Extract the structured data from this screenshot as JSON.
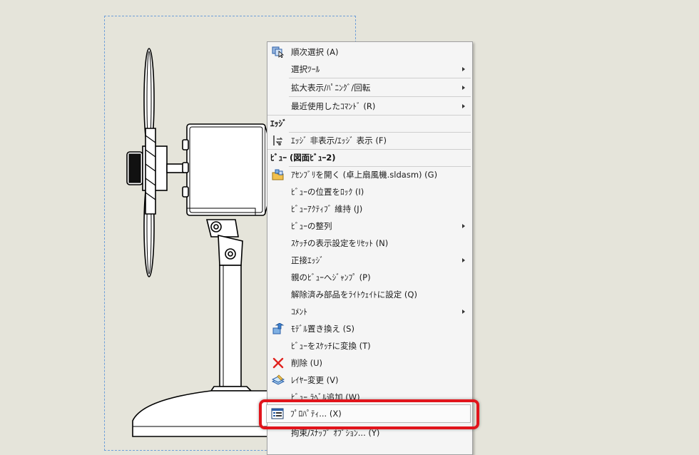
{
  "menu": {
    "items": [
      {
        "label": "順次選択 (A)",
        "icon": "select-other-icon",
        "submenu": false
      },
      {
        "label": "選択ﾂｰﾙ",
        "icon": "",
        "submenu": true
      },
      {
        "label": "拡大表示/ﾊﾟﾆﾝｸﾞ/回転",
        "icon": "",
        "submenu": true
      },
      {
        "label": "最近使用したｺﾏﾝﾄﾞ (R)",
        "icon": "",
        "submenu": true
      }
    ],
    "edge_header": "ｴｯｼﾞ",
    "edge_items": [
      {
        "label": "ｴｯｼﾞ 非表示/ｴｯｼﾞ 表示 (F)",
        "icon": "hide-show-edge-icon"
      }
    ],
    "view_header": "ﾋﾞｭｰ (図面ﾋﾞｭｰ2)",
    "view_items": [
      {
        "label": "ｱｾﾝﾌﾞﾘを開く (卓上扇風機.sldasm) (G)",
        "icon": "open-assembly-icon",
        "submenu": false
      },
      {
        "label": "ﾋﾞｭｰの位置をﾛｯｸ (I)",
        "icon": "",
        "submenu": false
      },
      {
        "label": "ﾋﾞｭｰｱｸﾃｨﾌﾞ 維持 (J)",
        "icon": "",
        "submenu": false
      },
      {
        "label": "ﾋﾞｭｰの整列",
        "icon": "",
        "submenu": true
      },
      {
        "label": "ｽｹｯﾁの表示設定をﾘｾｯﾄ (N)",
        "icon": "",
        "submenu": false
      },
      {
        "label": "正接ｴｯｼﾞ",
        "icon": "",
        "submenu": true
      },
      {
        "label": "親のﾋﾞｭｰへｼﾞｬﾝﾌﾟ (P)",
        "icon": "",
        "submenu": false
      },
      {
        "label": "解除済み部品をﾗｲﾄｳｪｲﾄに設定 (Q)",
        "icon": "",
        "submenu": false
      },
      {
        "label": "ｺﾒﾝﾄ",
        "icon": "",
        "submenu": true
      },
      {
        "label": "ﾓﾃﾞﾙ置き換え (S)",
        "icon": "replace-model-icon",
        "submenu": false
      },
      {
        "label": "ﾋﾞｭｰをｽｹｯﾁに変換 (T)",
        "icon": "",
        "submenu": false
      },
      {
        "label": "削除 (U)",
        "icon": "delete-icon",
        "submenu": false
      },
      {
        "label": "ﾚｲﾔｰ変更 (V)",
        "icon": "change-layer-icon",
        "submenu": false
      },
      {
        "label": "ﾋﾞｭｰ ﾗﾍﾞﾙ追加 (W)",
        "icon": "",
        "submenu": false
      },
      {
        "label": "ﾌﾟﾛﾊﾟﾃｨ... (X)",
        "icon": "properties-icon",
        "submenu": false
      },
      {
        "label": "拘束/ｽﾅｯﾌﾟ ｵﾌﾟｼｮﾝ... (Y)",
        "icon": "",
        "submenu": false
      }
    ]
  },
  "colors": {
    "highlight": "#e1141b",
    "view_border": "#6f9fd8",
    "background": "#e5e4da"
  }
}
